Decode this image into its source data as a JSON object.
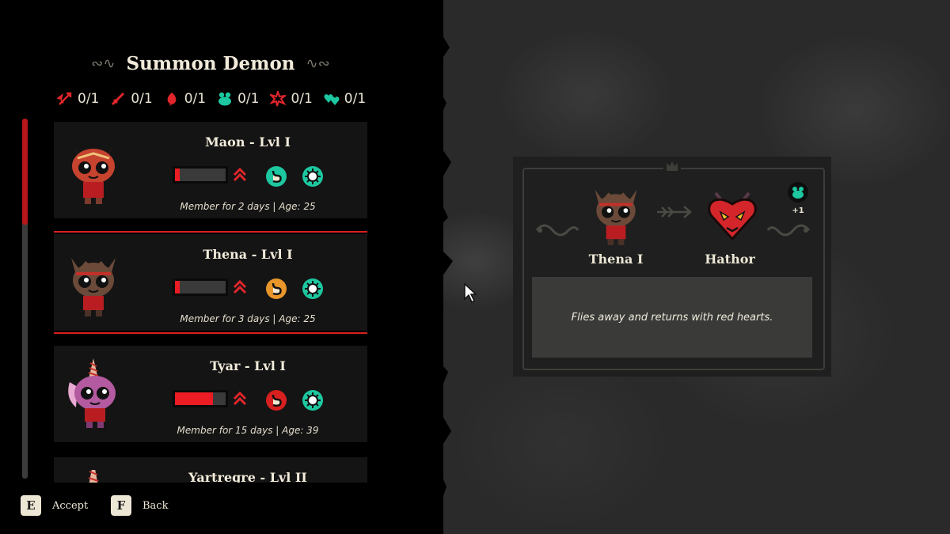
{
  "header": {
    "title": "Summon Demon"
  },
  "resources": [
    {
      "icon": "winged-sword-icon",
      "value": "0/1",
      "color": "#e0262b"
    },
    {
      "icon": "sword-icon",
      "value": "0/1",
      "color": "#e0262b"
    },
    {
      "icon": "blood-drop-icon",
      "value": "0/1",
      "color": "#e0262b"
    },
    {
      "icon": "frog-icon",
      "value": "0/1",
      "color": "#1dc7a0"
    },
    {
      "icon": "burst-star-icon",
      "value": "0/1",
      "color": "#e0262b"
    },
    {
      "icon": "twin-hearts-icon",
      "value": "0/1",
      "color": "#1dc7a0"
    }
  ],
  "followers": [
    {
      "name": "Maon - Lvl I",
      "meta": "Member for 2 days | Age: 25",
      "bar_level": 0.1,
      "species": "cat"
    },
    {
      "name": "Thena - Lvl I",
      "meta": "Member for 3 days | Age: 25",
      "bar_level": 0.1,
      "species": "bat",
      "selected": true
    },
    {
      "name": "Tyar - Lvl I",
      "meta": "Member for 15 days | Age: 39",
      "bar_level": 0.75,
      "species": "unicorn"
    },
    {
      "name": "Yartregre - Lvl II",
      "meta": "",
      "species": "unicorn"
    }
  ],
  "preview": {
    "follower_name": "Thena I",
    "demon_name": "Hathor",
    "bonus": "+1",
    "description": "Flies away and returns with red hearts."
  },
  "controls": {
    "accept_key": "E",
    "accept_label": "Accept",
    "back_key": "F",
    "back_label": "Back"
  },
  "colors": {
    "accent_red": "#d7201f",
    "teal": "#1dc7a0",
    "card_bg": "#141414",
    "text": "#ece6d6"
  }
}
